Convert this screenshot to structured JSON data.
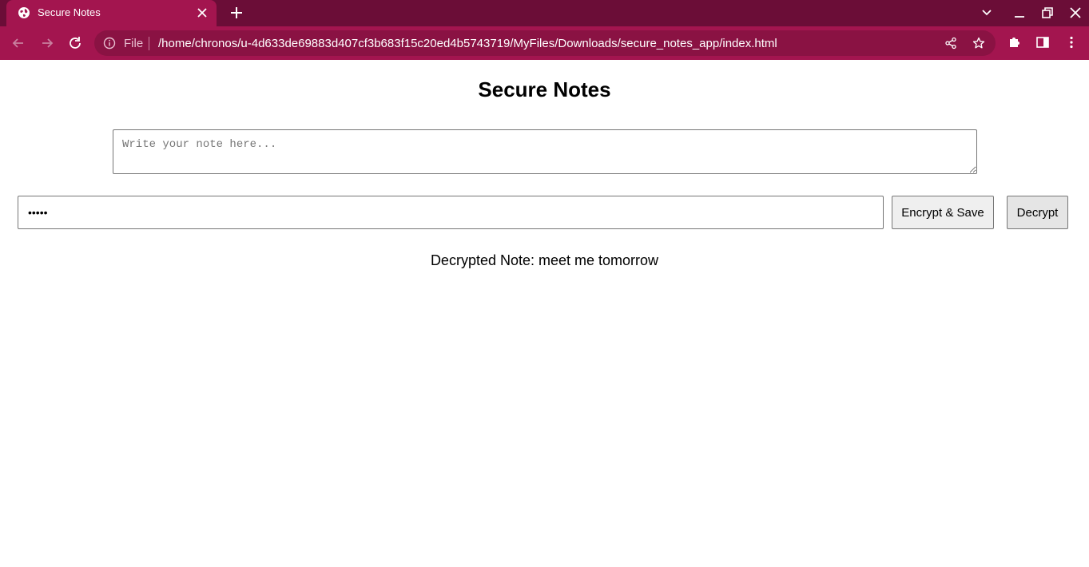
{
  "browser": {
    "tab_title": "Secure Notes",
    "omnibox": {
      "scheme_label": "File",
      "url": "/home/chronos/u-4d633de69883d407cf3b683f15c20ed4b5743719/MyFiles/Downloads/secure_notes_app/index.html"
    },
    "icons": [
      "globe-icon",
      "close-icon",
      "plus-icon",
      "chevron-down-icon",
      "minimize-icon",
      "restore-icon",
      "window-close-icon",
      "back-icon",
      "forward-icon",
      "reload-icon",
      "info-icon",
      "share-icon",
      "star-icon",
      "extensions-icon",
      "side-panel-icon",
      "menu-icon"
    ]
  },
  "colors": {
    "tabbar_bg": "#6b0d37",
    "toolbar_bg": "#a3154f",
    "omnibox_bg": "#8a1243"
  },
  "app": {
    "title": "Secure Notes",
    "note_placeholder": "Write your note here...",
    "note_value": "",
    "password_value": "•••••",
    "encrypt_button": "Encrypt & Save",
    "decrypt_button": "Decrypt",
    "result_text": "Decrypted Note: meet me tomorrow"
  }
}
